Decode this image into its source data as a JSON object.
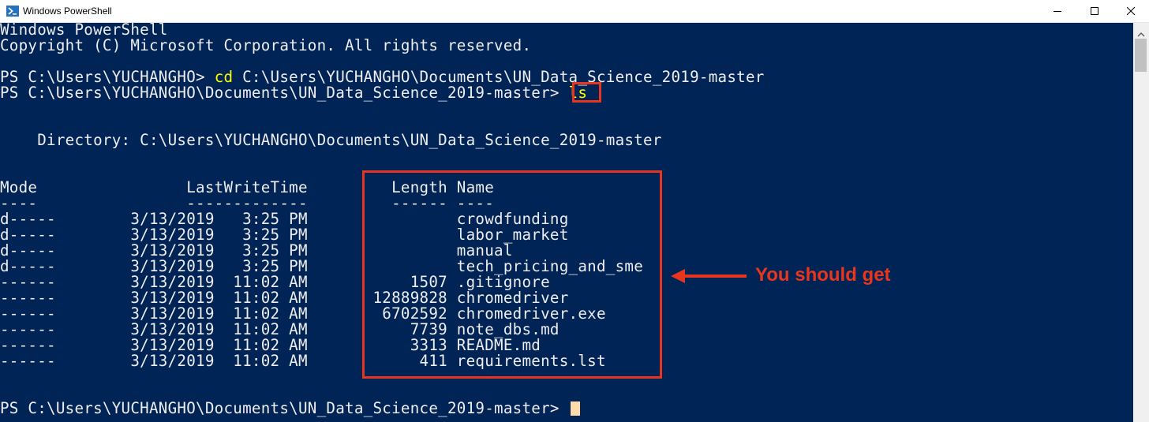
{
  "window": {
    "title": "Windows PowerShell",
    "controls": {
      "minimize": "minimize",
      "maximize": "maximize",
      "close": "close"
    }
  },
  "console": {
    "banner": [
      "Windows PowerShell",
      "Copyright (C) Microsoft Corporation. All rights reserved."
    ],
    "prompt": "PS C:\\Users\\YUCHANGHO> ",
    "prompt_full": "PS C:\\Users\\YUCHANGHO\\Documents\\UN_Data_Science_2019-master> ",
    "cmd1": "cd",
    "cmd1_arg": " C:\\Users\\YUCHANGHO\\Documents\\UN_Data_Science_2019-master",
    "cmd2": "ls",
    "directory_line": "    Directory: C:\\Users\\YUCHANGHO\\Documents\\UN_Data_Science_2019-master",
    "header_line": "Mode                LastWriteTime         Length Name",
    "underline_line": "----                -------------         ------ ----",
    "rows": [
      "d-----        3/13/2019   3:25 PM                crowdfunding",
      "d-----        3/13/2019   3:25 PM                labor_market",
      "d-----        3/13/2019   3:25 PM                manual",
      "d-----        3/13/2019   3:25 PM                tech_pricing_and_sme",
      "------        3/13/2019  11:02 AM           1507 .gitignore",
      "------        3/13/2019  11:02 AM       12889828 chromedriver",
      "------        3/13/2019  11:02 AM        6702592 chromedriver.exe",
      "------        3/13/2019  11:02 AM           7739 note_dbs.md",
      "------        3/13/2019  11:02 AM           3313 README.md",
      "------        3/13/2019  11:02 AM            411 requirements.lst"
    ]
  },
  "annotation": {
    "text": "You should get",
    "color": "#e8361e"
  },
  "colors": {
    "background": "#012456",
    "text": "#eeedf0",
    "command": "#ffff00",
    "cursor": "#fedba9"
  }
}
